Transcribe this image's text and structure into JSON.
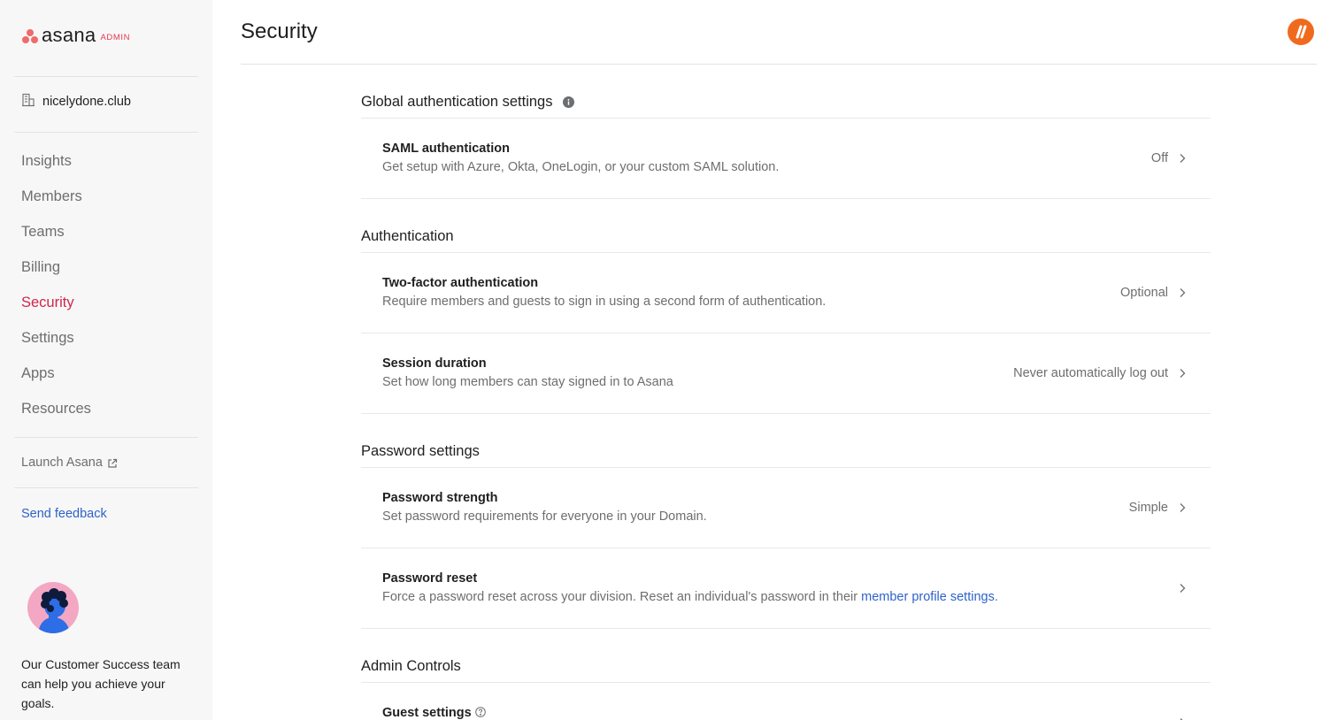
{
  "brand": {
    "name": "asana",
    "tag": "ADMIN"
  },
  "sidebar": {
    "org_name": "nicelydone.club",
    "nav": [
      {
        "label": "Insights",
        "active": false
      },
      {
        "label": "Members",
        "active": false
      },
      {
        "label": "Teams",
        "active": false
      },
      {
        "label": "Billing",
        "active": false
      },
      {
        "label": "Security",
        "active": true
      },
      {
        "label": "Settings",
        "active": false
      },
      {
        "label": "Apps",
        "active": false
      },
      {
        "label": "Resources",
        "active": false
      }
    ],
    "launch_label": "Launch Asana",
    "feedback_label": "Send feedback",
    "promo_text": "Our Customer Success team can help you achieve your goals."
  },
  "page": {
    "title": "Security"
  },
  "sections": {
    "global": {
      "heading": "Global authentication settings",
      "saml": {
        "title": "SAML authentication",
        "desc": "Get setup with Azure, Okta, OneLogin, or your custom SAML solution.",
        "value": "Off"
      }
    },
    "auth": {
      "heading": "Authentication",
      "two_factor": {
        "title": "Two-factor authentication",
        "desc": "Require members and guests to sign in using a second form of authentication.",
        "value": "Optional"
      },
      "session": {
        "title": "Session duration",
        "desc": "Set how long members can stay signed in to Asana",
        "value": "Never automatically log out"
      }
    },
    "password": {
      "heading": "Password settings",
      "strength": {
        "title": "Password strength",
        "desc": "Set password requirements for everyone in your Domain.",
        "value": "Simple"
      },
      "reset": {
        "title": "Password reset",
        "desc_prefix": "Force a password reset across your division. Reset an individual's password in their ",
        "desc_link": "member profile settings",
        "desc_suffix": "."
      }
    },
    "admin": {
      "heading": "Admin Controls",
      "guest": {
        "title": "Guest settings"
      }
    }
  },
  "colors": {
    "accent_active": "#d1254b",
    "link": "#2e62c8",
    "brand_coral": "#f06a6a",
    "badge": "#f06a1d"
  }
}
